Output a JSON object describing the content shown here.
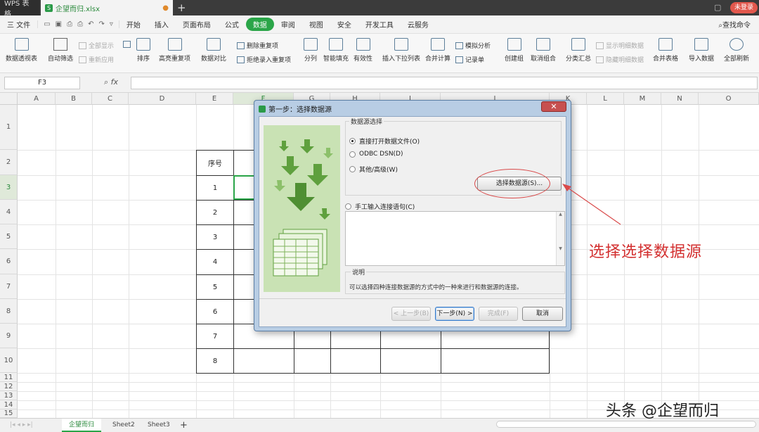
{
  "titlebar": {
    "app_tab": "WPS 表格",
    "file_tab": "企望而归.xlsx",
    "file_modified_marker": "●",
    "new_tab": "+",
    "login": "未登录"
  },
  "menubar": {
    "file_label": "三 文件",
    "items": [
      "开始",
      "插入",
      "页面布局",
      "公式",
      "数据",
      "审阅",
      "视图",
      "安全",
      "开发工具",
      "云服务"
    ],
    "active": "数据",
    "search_command": "查找命令"
  },
  "ribbon": {
    "pivot_table": "数据透视表",
    "auto_filter": "自动筛选",
    "show_all": "全部显示",
    "reapply": "重新应用",
    "sort": "排序",
    "highlight_dup": "高亮重复项",
    "data_compare": "数据对比",
    "delete_dup": "删除重复项",
    "reject_dup": "拒绝录入重复项",
    "split_col": "分列",
    "smart_fill": "智能填充",
    "validity": "有效性",
    "insert_dropdown": "插入下拉列表",
    "consolidate": "合并计算",
    "what_if": "模拟分析",
    "record_sheet": "记录单",
    "create_group": "创建组",
    "ungroup": "取消组合",
    "subtotal": "分类汇总",
    "show_detail": "显示明细数据",
    "hide_detail": "隐藏明细数据",
    "merge_tables": "合并表格",
    "import_data": "导入数据",
    "refresh_all": "全部刷新"
  },
  "formula": {
    "name_box": "F3",
    "fx": "fx",
    "value": ""
  },
  "grid": {
    "columns": [
      "A",
      "B",
      "C",
      "D",
      "E",
      "F",
      "G",
      "H",
      "I",
      "J",
      "K",
      "L",
      "M",
      "N",
      "O"
    ],
    "selected_column": "F",
    "rows": [
      "1",
      "2",
      "3",
      "4",
      "5",
      "6",
      "7",
      "8",
      "9",
      "10",
      "11",
      "12",
      "13",
      "14",
      "15"
    ],
    "selected_row": "3",
    "table_header": "序号",
    "serials": [
      "1",
      "2",
      "3",
      "4",
      "5",
      "6",
      "7",
      "8"
    ]
  },
  "dialog": {
    "title": "第一步：选择数据源",
    "close": "✕",
    "group_title": "数据源选择",
    "option_direct": "直接打开数据文件(O)",
    "option_odbc": "ODBC DSN(D)",
    "option_other": "其他/高级(W)",
    "select_source_button": "选择数据源(S)...",
    "option_manual": "手工输入连接语句(C)",
    "desc_title": "说明",
    "desc_text": "可以选择四种连接数据源的方式中的一种来进行和数据源的连接。",
    "btn_prev": "< 上一步(B)",
    "btn_next": "下一步(N) >",
    "btn_finish": "完成(F)",
    "btn_cancel": "取消",
    "selected_option": "直接打开数据文件(O)"
  },
  "annotation": {
    "text": "选择选择数据源",
    "color": "#d32f2f"
  },
  "sheets": {
    "tabs": [
      "企望而归",
      "Sheet2",
      "Sheet3"
    ],
    "active": "企望而归",
    "add": "+"
  },
  "watermark": "头条 @企望而归",
  "colors": {
    "accent": "#2aa548",
    "annotation_red": "#d32f2f"
  }
}
